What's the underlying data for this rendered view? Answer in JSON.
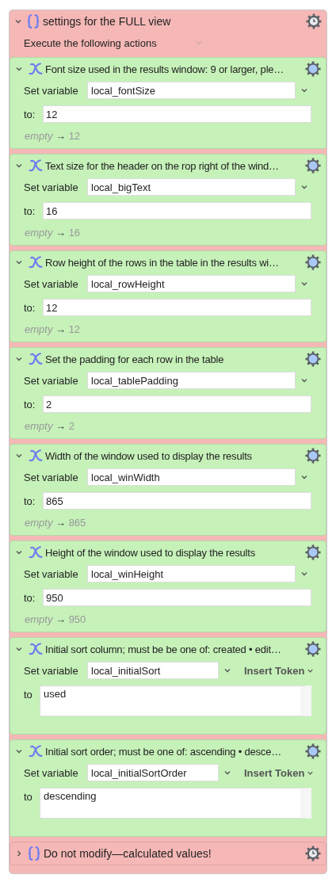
{
  "group": {
    "title": "settings for the FULL view",
    "expanded": true,
    "subtitle": "Execute the following actions",
    "actions": [
      {
        "kind": "set",
        "title": "Font size used in the results window: 9 or larger, ple…",
        "label": "Set variable",
        "variable": "local_fontSize",
        "to_label": "to:",
        "value": "12",
        "preview_empty": "empty",
        "preview_arrow": "→",
        "preview_value": "12"
      },
      {
        "kind": "set",
        "title": "Text size for the header on the rop right of the wind…",
        "label": "Set variable",
        "variable": "local_bigText",
        "to_label": "to:",
        "value": "16",
        "preview_empty": "empty",
        "preview_arrow": "→",
        "preview_value": "16"
      },
      {
        "kind": "set",
        "title": "Row height of the rows in the table in the results wi…",
        "label": "Set variable",
        "variable": "local_rowHeight",
        "to_label": "to:",
        "value": "12",
        "preview_empty": "empty",
        "preview_arrow": "→",
        "preview_value": "12"
      },
      {
        "kind": "set",
        "title": "Set the padding for each row in the table",
        "label": "Set variable",
        "variable": "local_tablePadding",
        "to_label": "to:",
        "value": "2",
        "preview_empty": "empty",
        "preview_arrow": "→",
        "preview_value": "2"
      },
      {
        "kind": "set",
        "title": "Width of the window used to display the results",
        "label": "Set variable",
        "variable": "local_winWidth",
        "to_label": "to:",
        "value": "865",
        "preview_empty": "empty",
        "preview_arrow": "→",
        "preview_value": "865"
      },
      {
        "kind": "set",
        "title": "Height of the window used to display the results",
        "label": "Set variable",
        "variable": "local_winHeight",
        "to_label": "to:",
        "value": "950",
        "preview_empty": "empty",
        "preview_arrow": "→",
        "preview_value": "950"
      },
      {
        "kind": "token",
        "title": "Initial sort column; must be be one of: created • edit…",
        "label": "Set variable",
        "variable": "local_initialSort",
        "token": "Insert Token",
        "to_label": "to",
        "value": "used"
      },
      {
        "kind": "token",
        "title": "Initial sort order; must be one of: ascending • desce…",
        "label": "Set variable",
        "variable": "local_initialSortOrder",
        "token": "Insert Token",
        "to_label": "to",
        "value": "descending"
      }
    ]
  },
  "footer_group": {
    "title": "Do not modify—calculated values!",
    "expanded": false
  }
}
